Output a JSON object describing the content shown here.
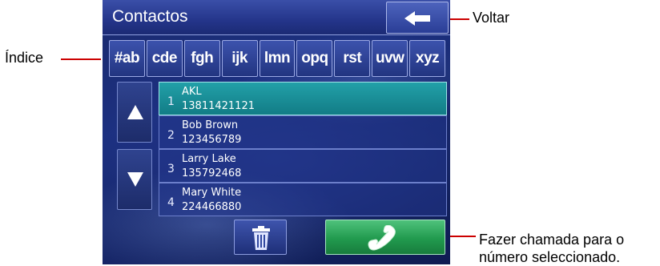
{
  "header": {
    "title": "Contactos"
  },
  "index_tabs": [
    "#ab",
    "cde",
    "fgh",
    "ijk",
    "lmn",
    "opq",
    "rst",
    "uvw",
    "xyz"
  ],
  "contacts": [
    {
      "num": "1",
      "name": "AKL",
      "phone": "13811421121",
      "selected": true
    },
    {
      "num": "2",
      "name": "Bob Brown",
      "phone": "123456789",
      "selected": false
    },
    {
      "num": "3",
      "name": "Larry Lake",
      "phone": "135792468",
      "selected": false
    },
    {
      "num": "4",
      "name": "Mary White",
      "phone": "224466880",
      "selected": false
    }
  ],
  "callouts": {
    "voltar": "Voltar",
    "indice": "Índice",
    "fazer_line1": "Fazer chamada para o",
    "fazer_line2": "número seleccionado."
  },
  "icons": {
    "back": "back-arrow-icon",
    "scroll_up": "triangle-up-icon",
    "scroll_down": "triangle-down-icon",
    "delete": "trash-icon",
    "call": "phone-handset-icon"
  },
  "colors": {
    "selected_row": "#1a8f99",
    "call_button": "#2aa558",
    "callout_line": "#cc0000"
  }
}
